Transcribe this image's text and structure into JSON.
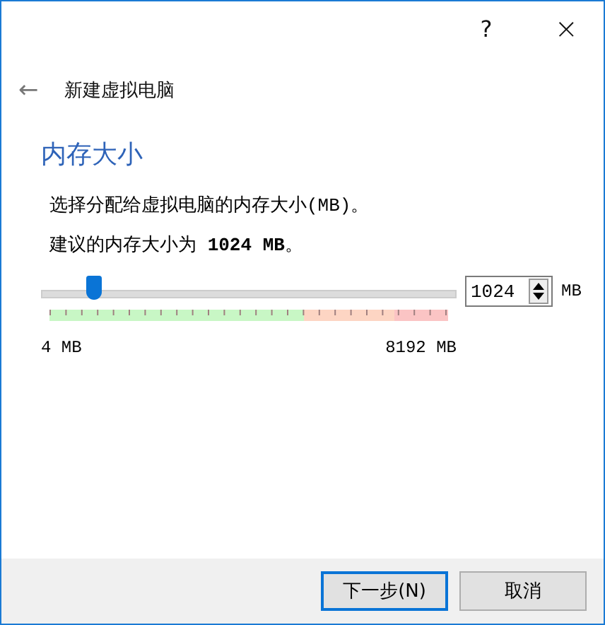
{
  "window": {
    "help": "?",
    "close": "×"
  },
  "header": {
    "back": "←",
    "title": "新建虚拟电脑"
  },
  "section": {
    "heading": "内存大小",
    "description": "选择分配给虚拟电脑的内存大小(MB)。",
    "recommendation": "建议的内存大小为 **1024 MB**。"
  },
  "memory": {
    "level": 0.125,
    "value": "1024",
    "unit": "MB",
    "min_label": "4 MB",
    "max_label": "8192 MB"
  },
  "buttons": [
    {
      "label": "下一步(N)",
      "default": true
    },
    {
      "label": "取消",
      "default": false
    }
  ]
}
